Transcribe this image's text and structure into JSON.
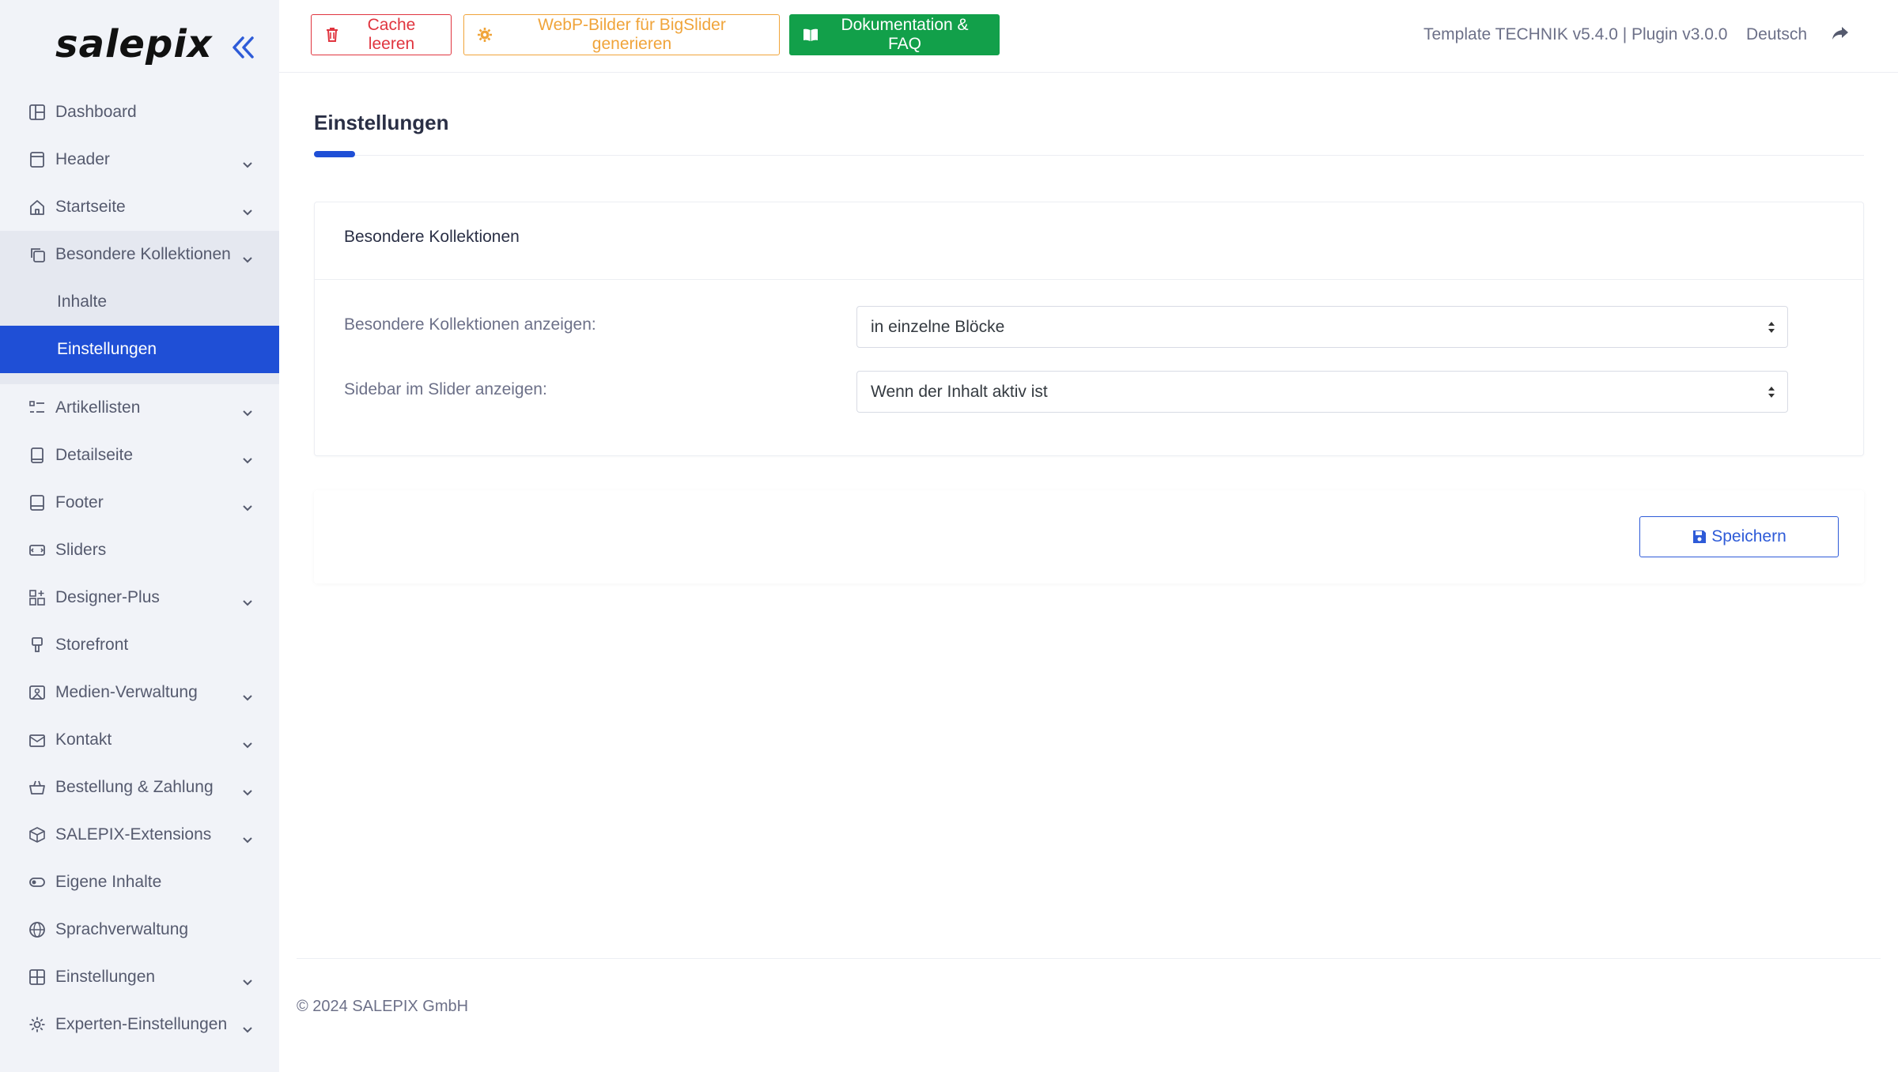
{
  "brand": {
    "logo": "salepix"
  },
  "sidebar": {
    "items": [
      {
        "label": "Dashboard",
        "icon": "layout-icon",
        "chevron": false
      },
      {
        "label": "Header",
        "icon": "header-icon",
        "chevron": true
      },
      {
        "label": "Startseite",
        "icon": "home-icon",
        "chevron": true
      }
    ],
    "group": {
      "label": "Besondere Kollektionen",
      "icon": "copy-icon",
      "children": [
        {
          "label": "Inhalte",
          "active": false
        },
        {
          "label": "Einstellungen",
          "active": true
        }
      ]
    },
    "items2": [
      {
        "label": "Artikellisten",
        "icon": "list-icon",
        "chevron": true
      },
      {
        "label": "Detailseite",
        "icon": "book-icon",
        "chevron": true
      },
      {
        "label": "Footer",
        "icon": "footer-icon",
        "chevron": true
      },
      {
        "label": "Sliders",
        "icon": "slider-icon",
        "chevron": false
      },
      {
        "label": "Designer-Plus",
        "icon": "grid-plus-icon",
        "chevron": true
      },
      {
        "label": "Storefront",
        "icon": "brush-icon",
        "chevron": false
      },
      {
        "label": "Medien-Verwaltung",
        "icon": "image-icon",
        "chevron": true
      },
      {
        "label": "Kontakt",
        "icon": "mail-icon",
        "chevron": true
      },
      {
        "label": "Bestellung & Zahlung",
        "icon": "basket-icon",
        "chevron": true
      },
      {
        "label": "SALEPIX-Extensions",
        "icon": "box-icon",
        "chevron": true
      },
      {
        "label": "Eigene Inhalte",
        "icon": "toggle-icon",
        "chevron": false
      },
      {
        "label": "Sprachverwaltung",
        "icon": "globe-icon",
        "chevron": false
      },
      {
        "label": "Einstellungen",
        "icon": "grid-icon",
        "chevron": true
      },
      {
        "label": "Experten-Einstellungen",
        "icon": "gear-icon",
        "chevron": true
      }
    ]
  },
  "toolbar": {
    "cache_label": "Cache leeren",
    "webp_label": "WebP-Bilder für BigSlider generieren",
    "doc_label": "Dokumentation & FAQ",
    "version_info": "Template TECHNIK v5.4.0 | Plugin v3.0.0",
    "language": "Deutsch"
  },
  "colors": {
    "accent": "#1f4fd6",
    "danger": "#e0353f",
    "warning": "#f0a43a",
    "success": "#12a04a"
  },
  "page": {
    "title": "Einstellungen"
  },
  "card": {
    "title": "Besondere Kollektionen",
    "fields": [
      {
        "label": "Besondere Kollektionen anzeigen:",
        "value": "in einzelne Blöcke"
      },
      {
        "label": "Sidebar im Slider anzeigen:",
        "value": "Wenn der Inhalt aktiv ist"
      }
    ]
  },
  "actions": {
    "save_label": "Speichern"
  },
  "footer": {
    "copyright": "© 2024 SALEPIX GmbH"
  }
}
